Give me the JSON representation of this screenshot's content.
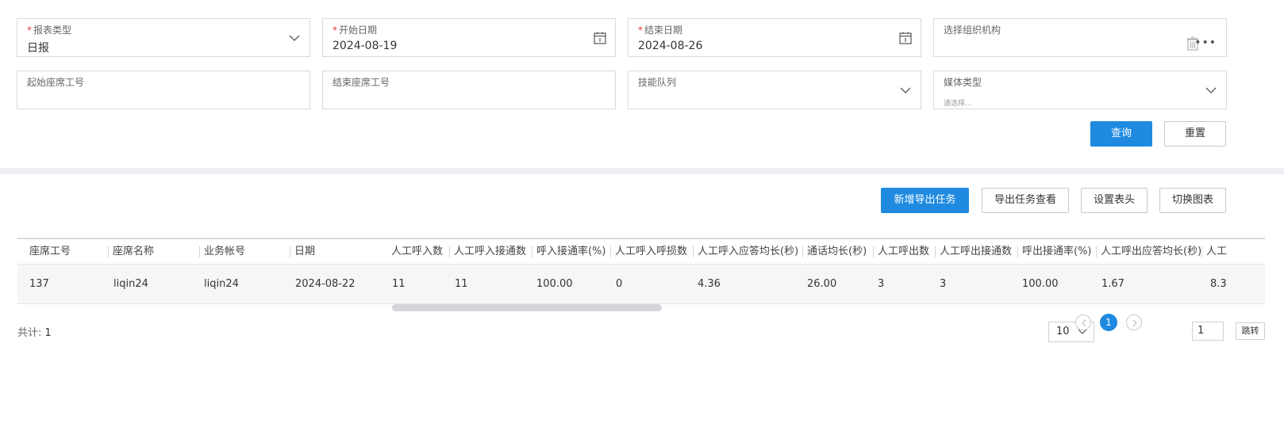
{
  "filters": [
    {
      "label": "报表类型",
      "required": true,
      "value": "日报",
      "icon": "chevron-down-icon"
    },
    {
      "label": "开始日期",
      "required": true,
      "value": "2024-08-19",
      "icon": "calendar-icon"
    },
    {
      "label": "结束日期",
      "required": true,
      "value": "2024-08-26",
      "icon": "calendar-icon"
    },
    {
      "label": "选择组织机构",
      "required": false,
      "value": "",
      "icon": "trash-icon"
    },
    {
      "label": "起始座席工号",
      "required": false,
      "value": ""
    },
    {
      "label": "结束座席工号",
      "required": false,
      "value": ""
    },
    {
      "label": "技能队列",
      "required": false,
      "value": "",
      "icon": "chevron-down-icon"
    },
    {
      "label": "媒体类型",
      "required": false,
      "value": "",
      "placeholder": "请选择...",
      "icon": "chevron-down-icon"
    }
  ],
  "required_mark": "*",
  "org_more": "•••",
  "buttons": {
    "query": "查询",
    "reset": "重置"
  },
  "toolbar": {
    "new_export": "新增导出任务",
    "view_export": "导出任务查看",
    "set_header": "设置表头",
    "switch_chart": "切换图表"
  },
  "table": {
    "columns": [
      "座席工号",
      "座席名称",
      "业务帐号",
      "日期",
      "人工呼入数",
      "人工呼入接通数",
      "呼入接通率(%)",
      "人工呼入呼损数",
      "人工呼入应答均长(秒)",
      "通话均长(秒)",
      "人工呼出数",
      "人工呼出接通数",
      "呼出接通率(%)",
      "人工呼出应答均长(秒)",
      "人工"
    ],
    "rows": [
      [
        "137",
        "liqin24",
        "liqin24",
        "2024-08-22",
        "11",
        "11",
        "100.00",
        "0",
        "4.36",
        "26.00",
        "3",
        "3",
        "100.00",
        "1.67",
        "8.3"
      ]
    ]
  },
  "footer": {
    "total_label": "共计:",
    "total_value": "1"
  },
  "pagination": {
    "page_size": "10",
    "current_page": "1",
    "jump_value": "1",
    "jump_label": "跳转",
    "prev_icon": "chevron-left-icon",
    "next_icon": "chevron-right-icon"
  },
  "colors": {
    "primary": "#1f8ae0",
    "required": "#e4393c",
    "divider": "#eef0f5",
    "row_bg": "#f5f6f8"
  }
}
